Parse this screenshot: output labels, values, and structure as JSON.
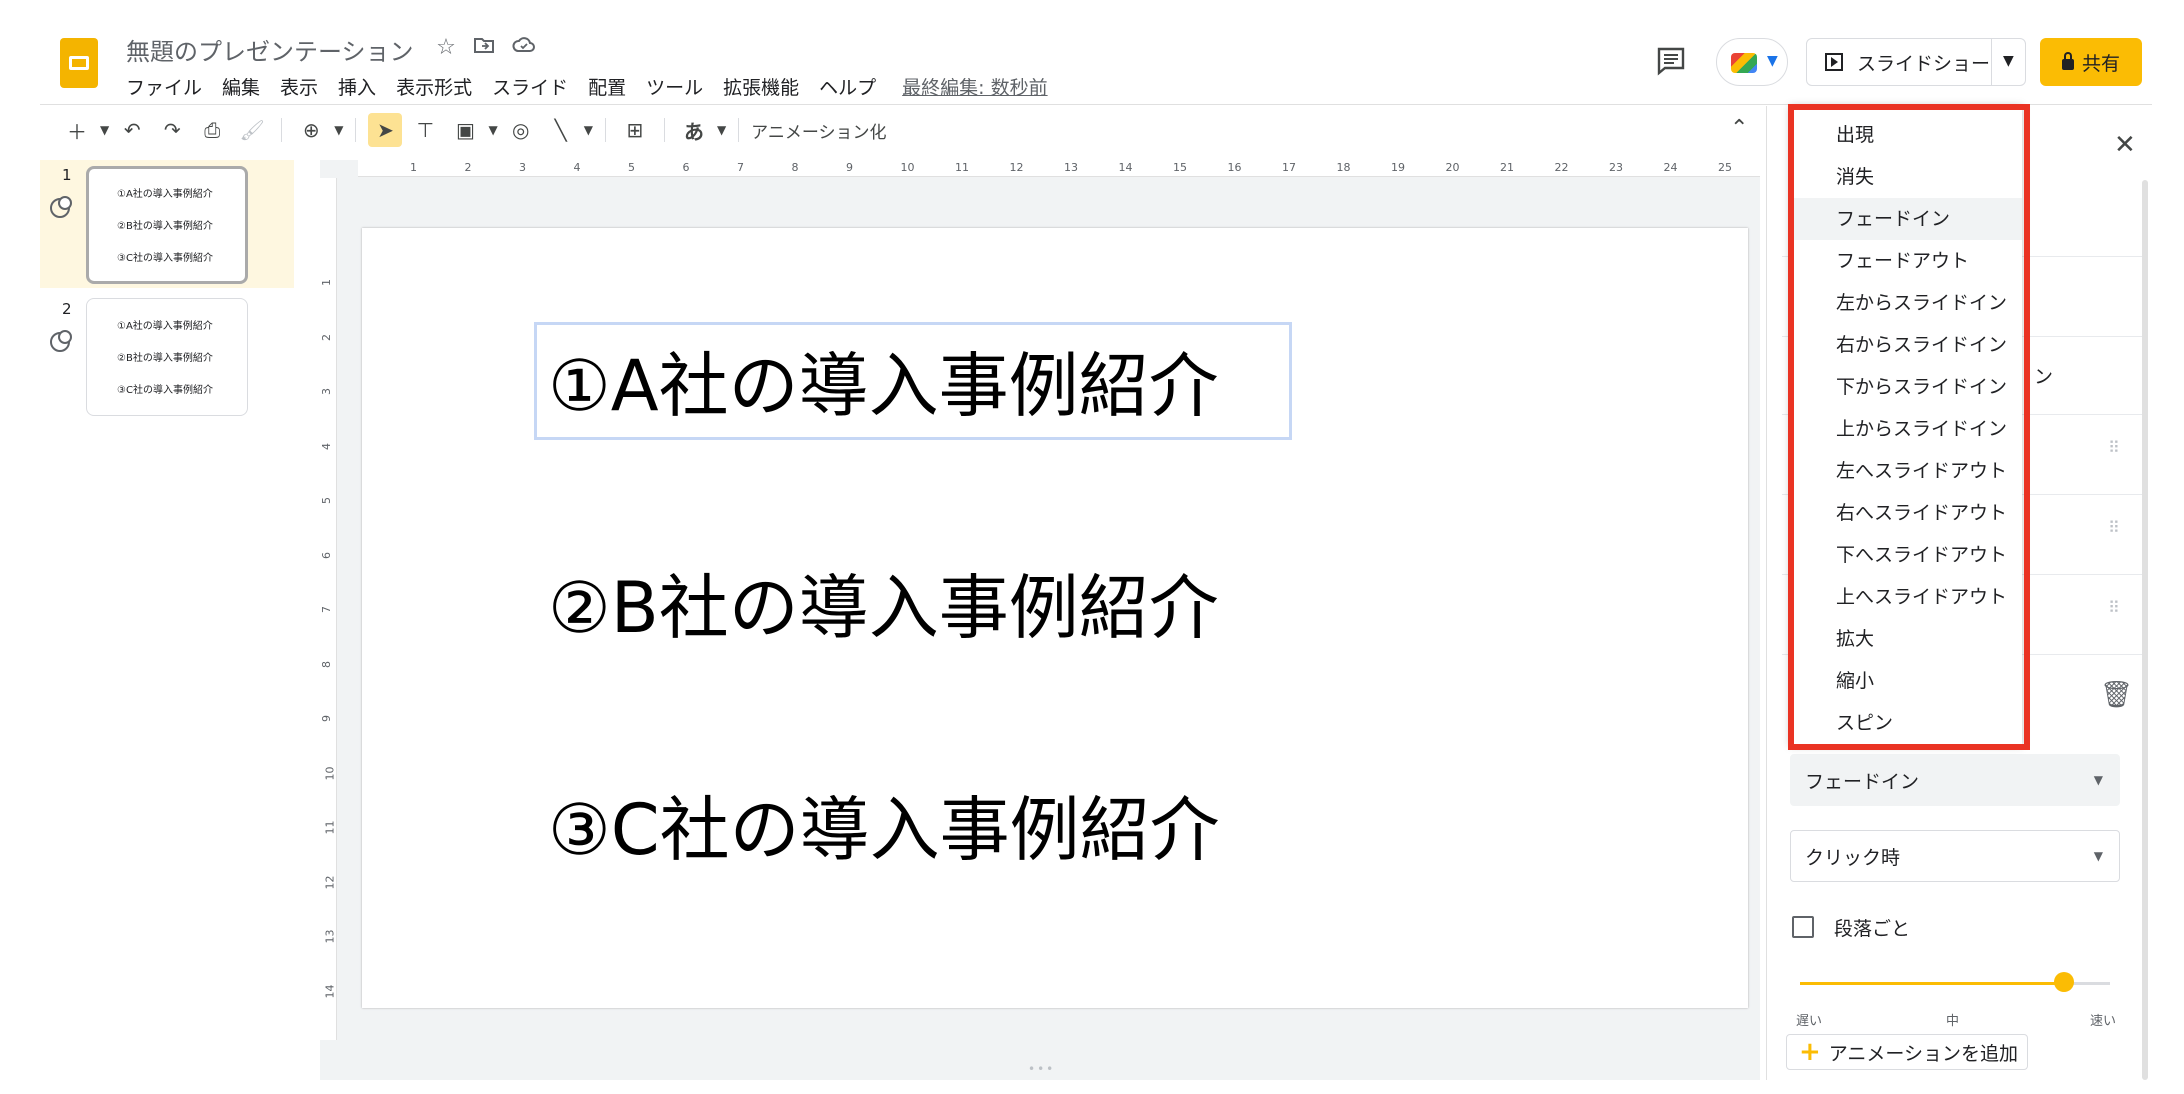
{
  "header": {
    "doc_title": "無題のプレゼンテーション",
    "last_edit": "最終編集: 数秒前",
    "menu": [
      "ファイル",
      "編集",
      "表示",
      "挿入",
      "表示形式",
      "スライド",
      "配置",
      "ツール",
      "拡張機能",
      "ヘルプ"
    ],
    "slideshow_label": "スライドショー",
    "share_label": "共有"
  },
  "toolbar": {
    "input_tool_label": "あ",
    "animation_label": "アニメーション化"
  },
  "ruler": {
    "h": [
      "1",
      "2",
      "3",
      "4",
      "5",
      "6",
      "7",
      "8",
      "9",
      "10",
      "11",
      "12",
      "13",
      "14",
      "15",
      "16",
      "17",
      "18",
      "19",
      "20",
      "21",
      "22",
      "23",
      "24",
      "25"
    ],
    "v": [
      "1",
      "2",
      "3",
      "4",
      "5",
      "6",
      "7",
      "8",
      "9",
      "10",
      "11",
      "12",
      "13",
      "14"
    ]
  },
  "filmstrip": {
    "slides": [
      {
        "num": "1",
        "lines": [
          "①A社の導入事例紹介",
          "②B社の導入事例紹介",
          "③C社の導入事例紹介"
        ]
      },
      {
        "num": "2",
        "lines": [
          "①A社の導入事例紹介",
          "②B社の導入事例紹介",
          "③C社の導入事例紹介"
        ]
      }
    ]
  },
  "slide": {
    "lines": [
      "①A社の導入事例紹介",
      "②B社の導入事例紹介",
      "③C社の導入事例紹介"
    ]
  },
  "panel": {
    "partial_suffix": "ン",
    "effect_value": "フェードイン",
    "trigger_value": "クリック時",
    "by_paragraph_label": "段落ごと",
    "speed_labels": [
      "遅い",
      "中",
      "速い"
    ],
    "speed_level": 0.85,
    "add_animation_label": "アニメーションを追加"
  },
  "dropdown": {
    "items": [
      "出現",
      "消失",
      "フェードイン",
      "フェードアウト",
      "左からスライドイン",
      "右からスライドイン",
      "下からスライドイン",
      "上からスライドイン",
      "左へスライドアウト",
      "右へスライドアウト",
      "下へスライドアウト",
      "上へスライドアウト",
      "拡大",
      "縮小",
      "スピン"
    ],
    "hovered_index": 2
  },
  "colors": {
    "highlight": "#ea3323",
    "accent": "#fbbc04",
    "selection": "#c6d7f5"
  }
}
